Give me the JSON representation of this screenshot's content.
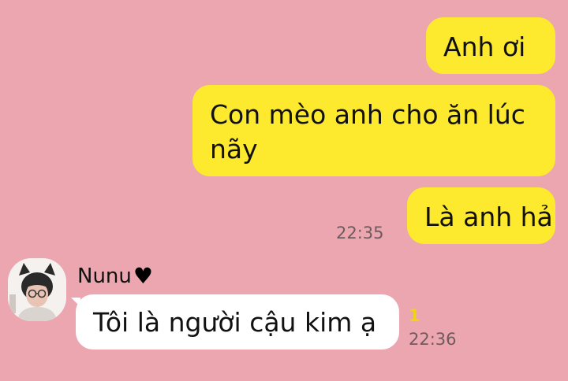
{
  "messages": [
    {
      "direction": "outgoing",
      "text": "Anh ơi"
    },
    {
      "direction": "outgoing",
      "text": "Con mèo anh cho ăn lúc nãy"
    },
    {
      "direction": "outgoing",
      "text": "Là anh hả",
      "time": "22:35"
    },
    {
      "direction": "incoming",
      "sender": "Nunu",
      "text": "Tôi là người cậu kim ạ",
      "time": "22:36",
      "unread_count": "1"
    }
  ],
  "icons": {
    "sender_badge": "black-heart-icon",
    "avatar": "profile-avatar-icon"
  },
  "colors": {
    "background": "#EBA6B0",
    "outgoing_bubble": "#FDE92E",
    "incoming_bubble": "#FFFFFF",
    "unread": "#F0D21A",
    "timestamp": "#6F5A5E"
  }
}
